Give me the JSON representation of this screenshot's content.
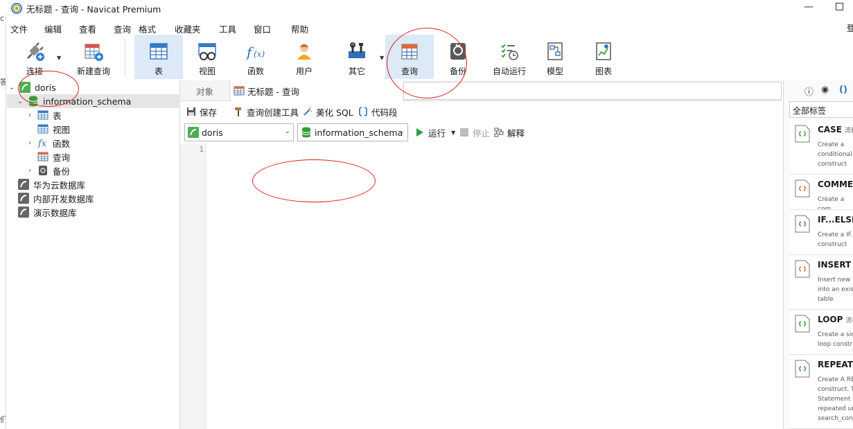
{
  "window": {
    "title": "无标题 - 查询 - Navicat Premium",
    "login_text": "登"
  },
  "menu": [
    "文件",
    "编辑",
    "查看",
    "查询",
    "格式",
    "收藏夹",
    "工具",
    "窗口",
    "帮助"
  ],
  "left_sliver": [
    "c",
    "答",
    "们"
  ],
  "toolbar": {
    "connect": "连接",
    "new_query": "新建查询",
    "table": "表",
    "view": "视图",
    "function": "函数",
    "user": "用户",
    "other": "其它",
    "query": "查询",
    "backup": "备份",
    "automation": "自动运行",
    "model": "模型",
    "chart": "图表"
  },
  "navigator": {
    "connection": "doris",
    "database": "information_schema",
    "children": [
      "表",
      "视图",
      "函数",
      "查询",
      "备份"
    ],
    "other_connections": [
      "华为云数据库",
      "内部开发数据库",
      "演示数据库"
    ]
  },
  "tabs": {
    "objects": "对象",
    "query_tab": "无标题 - 查询"
  },
  "query_toolbar": {
    "save": "保存",
    "builder": "查询创建工具",
    "beautify": "美化 SQL",
    "snippet": "代码段"
  },
  "query_selectors": {
    "connection": "doris",
    "database": "information_schema",
    "run": "运行",
    "stop": "停止",
    "explain": "解释"
  },
  "editor": {
    "line_number": "1"
  },
  "right_panel": {
    "filter": "全部标签",
    "snippets": [
      {
        "title": "CASE",
        "tag": "流程",
        "desc": "Create a conditional construct"
      },
      {
        "title": "COMMEN",
        "tag": "",
        "desc": "Create a com"
      },
      {
        "title": "IF...ELSE..",
        "tag": "",
        "desc": "Create a IF... construct"
      },
      {
        "title": "INSERT S",
        "tag": "",
        "desc": "Insert new r into an exist table"
      },
      {
        "title": "LOOP",
        "tag": "流程",
        "desc": "Create a sim loop constr"
      },
      {
        "title": "REPEAT",
        "tag": "",
        "desc": "Create A REI construct. T Statement lis repeated un search_cond"
      }
    ]
  },
  "colors": {
    "annotation": "#e0201b",
    "active_tool": "#dce9f7",
    "selected_row": "#e5e5e5",
    "run_green": "#2ea043"
  }
}
